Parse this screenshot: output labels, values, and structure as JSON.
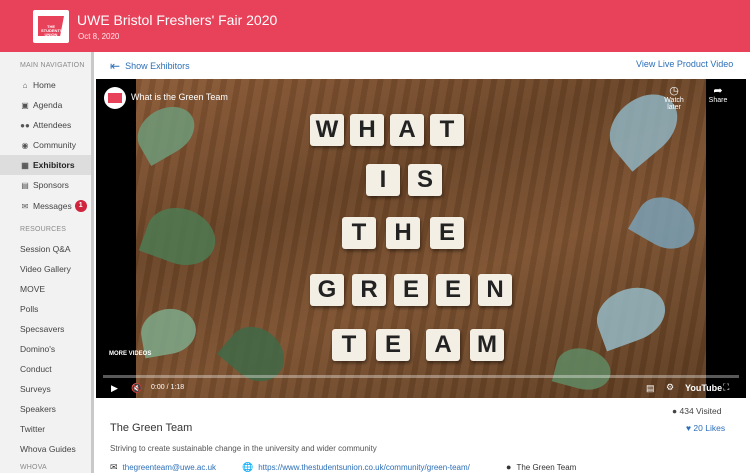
{
  "header": {
    "logo_text": "THE STUDENTS' UNION",
    "title": "UWE Bristol Freshers' Fair 2020",
    "date": "Oct 8, 2020",
    "color": "#e8415a"
  },
  "sidebar": {
    "main_heading": "MAIN NAVIGATION",
    "main_items": [
      {
        "label": "Home",
        "icon": "home-icon"
      },
      {
        "label": "Agenda",
        "icon": "calendar-icon"
      },
      {
        "label": "Attendees",
        "icon": "users-icon"
      },
      {
        "label": "Community",
        "icon": "chat-icon"
      },
      {
        "label": "Exhibitors",
        "icon": "building-icon",
        "active": true
      },
      {
        "label": "Sponsors",
        "icon": "sponsor-icon"
      },
      {
        "label": "Messages",
        "icon": "envelope-icon",
        "badge": "1"
      }
    ],
    "resources_heading": "RESOURCES",
    "resource_items": [
      "Session Q&A",
      "Video Gallery",
      "MOVE",
      "Polls",
      "Specsavers",
      "Domino's",
      "Conduct",
      "Surveys",
      "Speakers",
      "Twitter",
      "Whova Guides"
    ],
    "bottom_heading": "WHOVA"
  },
  "topbar": {
    "show_exhibitors": "Show Exhibitors",
    "live_video": "View Live Product Video"
  },
  "video": {
    "title": "What is the Green Team",
    "watch_later": "Watch later",
    "share": "Share",
    "more_videos": "MORE VIDEOS",
    "time": "0:00 / 1:18",
    "youtube": "YouTube",
    "tiles": [
      "W",
      "H",
      "A",
      "T",
      "I",
      "S",
      "T",
      "H",
      "E",
      "G",
      "R",
      "E",
      "E",
      "N",
      "T",
      "E",
      "A",
      "M"
    ]
  },
  "exhibitor": {
    "name": "The Green Team",
    "description": "Striving to create sustainable change in the university and wider community",
    "visited": "434 Visited",
    "likes": "20 Likes",
    "email": "thegreenteam@uwe.ac.uk",
    "website": "https://www.thestudentsunion.co.uk/community/green-team/",
    "contact_name": "The Green Team"
  }
}
